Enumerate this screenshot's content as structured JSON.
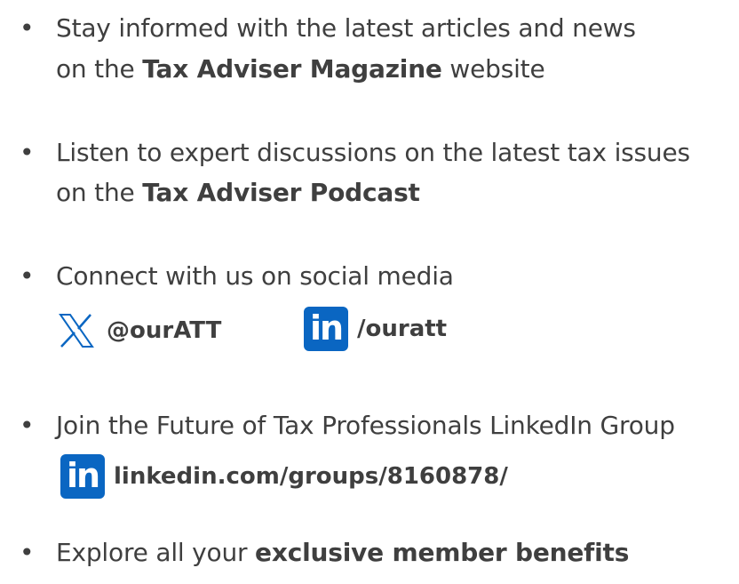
{
  "items": [
    {
      "bullet": "•",
      "line1": "Stay informed with the latest articles and news",
      "line2_pre": "on the ",
      "line2_bold": "Tax Adviser Magazine",
      "line2_post": " website"
    },
    {
      "bullet": "•",
      "line1": "Listen to expert discussions on the latest tax issues",
      "line2_pre": "on the ",
      "line2_bold": "Tax Adviser Podcast"
    },
    {
      "bullet": "•",
      "line1": "Connect with us on social media",
      "x_handle": "@ourATT",
      "linkedin_handle": "/ouratt"
    },
    {
      "bullet": "•",
      "line1": "Join the Future of Tax Professionals LinkedIn Group",
      "link": "linkedin.com/groups/8160878/"
    },
    {
      "bullet": "•",
      "line1_pre": "Explore all your ",
      "line1_bold": "exclusive member benefits"
    }
  ],
  "icons": {
    "x": "x-logo-icon",
    "linkedin": "linkedin-logo-icon",
    "linkedin_badge_text": "in"
  },
  "colors": {
    "text": "#3f3f3f",
    "linkedin_blue": "#0a66c2"
  }
}
